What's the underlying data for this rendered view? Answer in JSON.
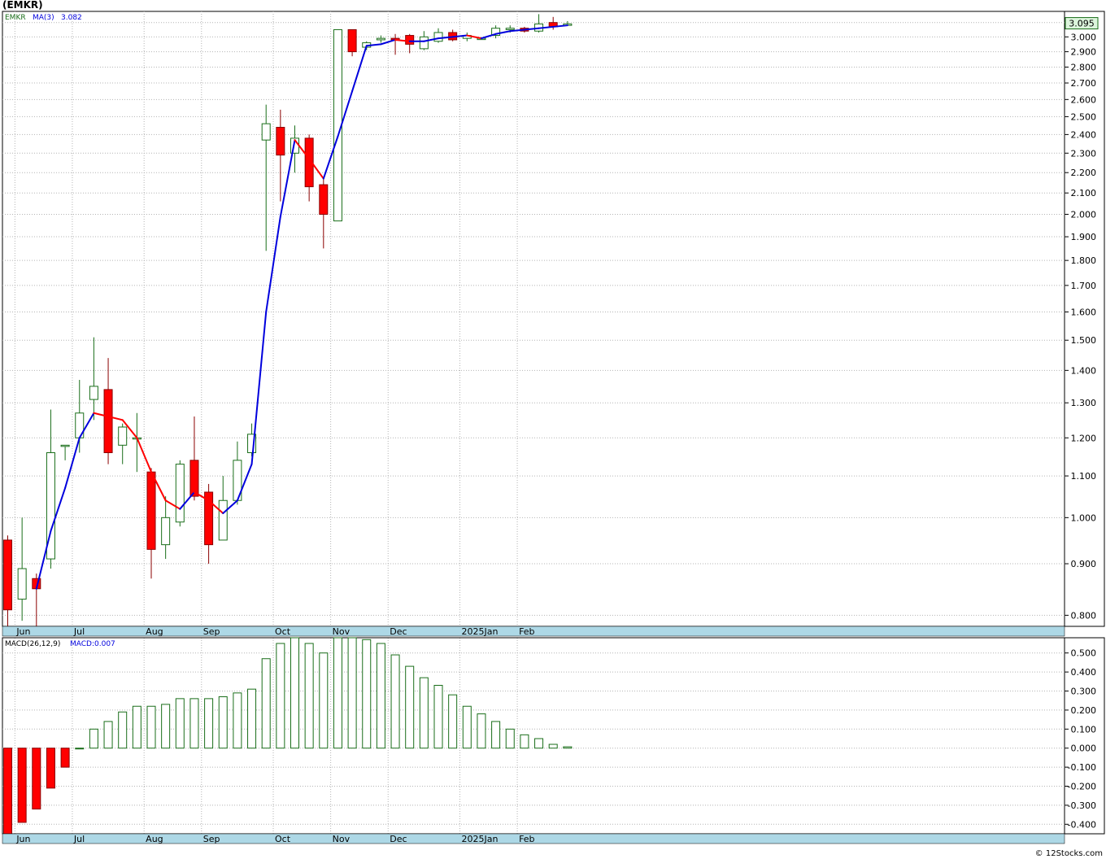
{
  "title": "(EMKR)",
  "footer": "© 12Stocks.com",
  "colors": {
    "up_candle": "#1a6e1a",
    "down_candle": "#ff0000",
    "ma_rising": "#0000dd",
    "ma_falling": "#ff0000",
    "macd_positive": "#1a6e1a",
    "macd_negative": "#ff0000",
    "grid": "#b4b4b4",
    "axis_band": "#add8e6",
    "price_tag_bg": "#dcf5dc"
  },
  "price_panel": {
    "legend_symbol": "EMKR",
    "legend_ma_label": "MA(3)",
    "legend_ma_value": "3.082",
    "last_price": "3.095",
    "scale": "log",
    "ylim": [
      0.78,
      3.18
    ],
    "tick_labels": [
      "0.800",
      "0.900",
      "1.000",
      "1.100",
      "1.200",
      "1.300",
      "1.400",
      "1.500",
      "1.600",
      "1.700",
      "1.800",
      "1.900",
      "2.000",
      "2.100",
      "2.200",
      "2.300",
      "2.400",
      "2.500",
      "2.600",
      "2.700",
      "2.800",
      "2.900",
      "3.000",
      "3.100"
    ]
  },
  "macd_panel": {
    "legend_label": "MACD(26,12,9)",
    "legend_value": "MACD:0.007",
    "ylim": [
      -0.45,
      0.58
    ],
    "tick_labels": [
      "-0.400",
      "-0.300",
      "-0.200",
      "-0.100",
      "0.000",
      "0.100",
      "0.200",
      "0.300",
      "0.400",
      "0.500"
    ]
  },
  "x_axis": {
    "month_labels": [
      {
        "label": "Jun",
        "week": 1
      },
      {
        "label": "Jul",
        "week": 5
      },
      {
        "label": "Aug",
        "week": 10
      },
      {
        "label": "Sep",
        "week": 14
      },
      {
        "label": "Oct",
        "week": 19
      },
      {
        "label": "Nov",
        "week": 23
      },
      {
        "label": "Dec",
        "week": 27
      },
      {
        "label": "2025Jan",
        "week": 32
      },
      {
        "label": "Feb",
        "week": 36
      }
    ]
  },
  "chart_data": [
    {
      "type": "candlestick",
      "interval": "weekly",
      "ticker": "EMKR",
      "series": [
        {
          "name": "EMKR",
          "ohlc": [
            [
              0.95,
              0.96,
              0.78,
              0.81
            ],
            [
              0.83,
              1.0,
              0.79,
              0.89
            ],
            [
              0.87,
              0.88,
              0.78,
              0.85
            ],
            [
              0.91,
              1.28,
              0.89,
              1.16
            ],
            [
              1.18,
              1.18,
              1.14,
              1.18
            ],
            [
              1.2,
              1.37,
              1.16,
              1.27
            ],
            [
              1.31,
              1.51,
              1.25,
              1.35
            ],
            [
              1.34,
              1.44,
              1.13,
              1.16
            ],
            [
              1.18,
              1.24,
              1.13,
              1.23
            ],
            [
              1.2,
              1.27,
              1.11,
              1.2
            ],
            [
              1.11,
              1.12,
              0.87,
              0.93
            ],
            [
              0.94,
              1.05,
              0.91,
              1.0
            ],
            [
              0.99,
              1.14,
              0.98,
              1.13
            ],
            [
              1.14,
              1.26,
              1.04,
              1.05
            ],
            [
              1.06,
              1.08,
              0.9,
              0.94
            ],
            [
              0.95,
              1.1,
              0.95,
              1.04
            ],
            [
              1.04,
              1.19,
              1.03,
              1.14
            ],
            [
              1.16,
              1.24,
              1.15,
              1.21
            ],
            [
              2.37,
              2.57,
              1.84,
              2.46
            ],
            [
              2.44,
              2.54,
              2.06,
              2.29
            ],
            [
              2.3,
              2.45,
              2.2,
              2.38
            ],
            [
              2.38,
              2.4,
              2.06,
              2.13
            ],
            [
              2.14,
              2.17,
              1.85,
              2.0
            ],
            [
              1.97,
              3.05,
              1.97,
              3.05
            ],
            [
              3.05,
              3.05,
              2.87,
              2.9
            ],
            [
              2.93,
              2.97,
              2.91,
              2.96
            ],
            [
              2.98,
              3.01,
              2.96,
              2.99
            ],
            [
              2.99,
              3.02,
              2.88,
              2.98
            ],
            [
              3.01,
              3.02,
              2.89,
              2.95
            ],
            [
              2.92,
              3.04,
              2.91,
              3.0
            ],
            [
              2.97,
              3.06,
              2.96,
              3.03
            ],
            [
              3.03,
              3.05,
              2.97,
              2.98
            ],
            [
              2.99,
              3.03,
              2.97,
              3.01
            ],
            [
              2.99,
              2.99,
              2.99,
              2.99
            ],
            [
              3.01,
              3.08,
              2.99,
              3.06
            ],
            [
              3.05,
              3.08,
              3.03,
              3.06
            ],
            [
              3.06,
              3.07,
              3.03,
              3.04
            ],
            [
              3.04,
              3.16,
              3.03,
              3.09
            ],
            [
              3.1,
              3.14,
              3.05,
              3.07
            ],
            [
              3.08,
              3.11,
              3.08,
              3.09
            ]
          ]
        },
        {
          "name": "MA(3)",
          "values": [
            null,
            null,
            0.85,
            0.97,
            1.07,
            1.2,
            1.27,
            1.26,
            1.25,
            1.2,
            1.11,
            1.04,
            1.02,
            1.06,
            1.04,
            1.01,
            1.04,
            1.13,
            1.6,
            1.99,
            2.37,
            2.27,
            2.17,
            2.39,
            2.65,
            2.94,
            2.95,
            2.98,
            2.97,
            2.97,
            2.99,
            3.0,
            3.01,
            2.99,
            3.02,
            3.04,
            3.05,
            3.06,
            3.07,
            3.08
          ]
        }
      ]
    },
    {
      "type": "bar",
      "name": "MACD(26,12,9)",
      "values": [
        -0.45,
        -0.39,
        -0.32,
        -0.21,
        -0.1,
        0.0,
        0.1,
        0.14,
        0.19,
        0.22,
        0.22,
        0.23,
        0.26,
        0.26,
        0.26,
        0.27,
        0.29,
        0.31,
        0.47,
        0.55,
        0.58,
        0.55,
        0.5,
        0.58,
        0.58,
        0.57,
        0.55,
        0.49,
        0.43,
        0.37,
        0.33,
        0.28,
        0.22,
        0.18,
        0.14,
        0.1,
        0.07,
        0.05,
        0.02,
        0.007
      ]
    }
  ]
}
